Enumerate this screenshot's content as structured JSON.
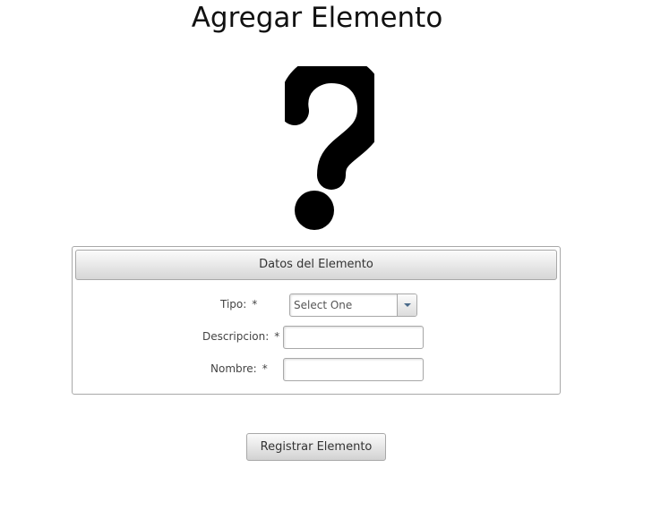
{
  "page": {
    "title": "Agregar Elemento",
    "image_icon": "question-mark-icon"
  },
  "panel": {
    "header": "Datos del Elemento",
    "fields": {
      "tipo": {
        "label": "Tipo:",
        "required_marker": "*",
        "selected": "Select One",
        "icon": "chevron-down-icon"
      },
      "descripcion": {
        "label": "Descripcion:",
        "required_marker": "*",
        "value": ""
      },
      "nombre": {
        "label": "Nombre:",
        "required_marker": "*",
        "value": ""
      }
    }
  },
  "actions": {
    "submit_label": "Registrar Elemento"
  },
  "colors": {
    "title": "#111111",
    "border": "#a8a8a8",
    "arrow": "#4a6a8a"
  }
}
